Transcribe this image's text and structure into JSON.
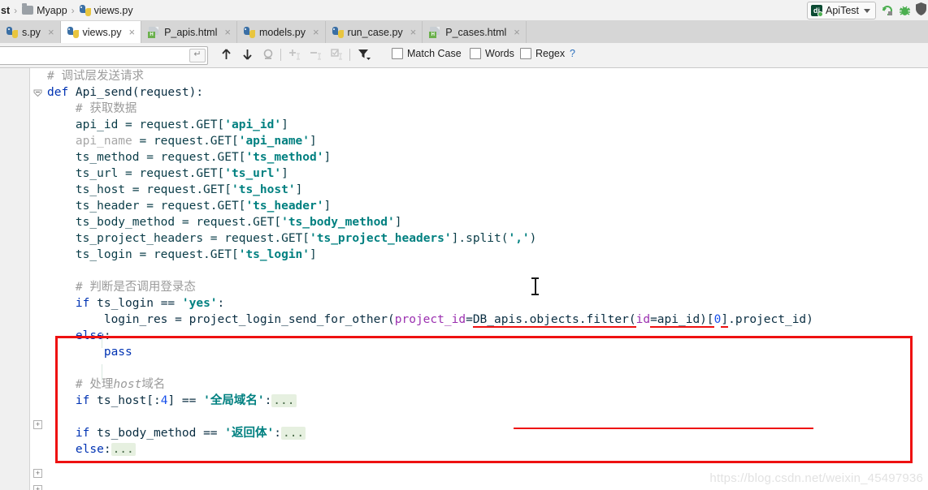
{
  "breadcrumb": {
    "items": [
      {
        "label": "st",
        "icon": "",
        "truncated": true
      },
      {
        "label": "Myapp",
        "icon": "folder-icon"
      },
      {
        "label": "views.py",
        "icon": "python-file-icon"
      }
    ],
    "separator": "›"
  },
  "run_widgets": {
    "config_name": "ApiTest",
    "config_icon": "django-icon",
    "dropdown_caret": "▾",
    "run_icon": "run-icon",
    "debug_icon": "debug-bug-icon",
    "coverage_icon": "shield-icon"
  },
  "tabs": [
    {
      "label": "s.py",
      "icon": "python-file-icon",
      "active": false,
      "close": "×",
      "truncated": true
    },
    {
      "label": "views.py",
      "icon": "python-file-icon",
      "active": true,
      "close": "×"
    },
    {
      "label": "P_apis.html",
      "icon": "html-file-icon",
      "active": false,
      "close": "×"
    },
    {
      "label": "models.py",
      "icon": "python-file-icon",
      "active": false,
      "close": "×"
    },
    {
      "label": "run_case.py",
      "icon": "python-file-icon",
      "active": false,
      "close": "×"
    },
    {
      "label": "P_cases.html",
      "icon": "html-file-icon",
      "active": false,
      "close": "×"
    }
  ],
  "find_bar": {
    "input_value": "",
    "input_placeholder": "",
    "enter_icon": "↵",
    "buttons": [
      {
        "name": "find-previous-button",
        "glyph": "↑",
        "enabled": true
      },
      {
        "name": "find-next-button",
        "glyph": "↓",
        "enabled": true
      },
      {
        "name": "select-all-occurrences-button",
        "glyph": "○",
        "enabled": true
      },
      {
        "name": "add-selection-button",
        "glyph": "+",
        "enabled": false
      },
      {
        "name": "remove-selection-button",
        "glyph": "−",
        "enabled": false
      },
      {
        "name": "select-all-button",
        "glyph": "☑",
        "enabled": false
      },
      {
        "name": "filter-button",
        "glyph": "▼",
        "enabled": true
      }
    ],
    "checkboxes": [
      {
        "label": "Match Case",
        "mnemonic": "C",
        "checked": false
      },
      {
        "label": "Words",
        "mnemonic": "o",
        "checked": false
      },
      {
        "label": "Regex",
        "mnemonic": "x",
        "checked": false
      }
    ],
    "help_label": "?",
    "scope_toggle": ""
  },
  "editor": {
    "language": "Python",
    "file": "views.py",
    "code_lines": [
      {
        "indent": 0,
        "tokens": [
          {
            "t": "cmt",
            "s": "# 调试层发送请求"
          }
        ],
        "fold": "collapse-arrow",
        "ctx": false
      },
      {
        "indent": 0,
        "tokens": [
          {
            "t": "kw",
            "s": "def"
          },
          {
            "t": "plain",
            "s": " Api_send(request):"
          }
        ],
        "ctx": false
      },
      {
        "indent": 1,
        "tokens": [
          {
            "t": "cmt",
            "s": "# 获取数据"
          }
        ],
        "ctx": true
      },
      {
        "indent": 1,
        "tokens": [
          {
            "t": "teal",
            "s": "api_id = request.GET["
          },
          {
            "t": "str",
            "s": "'api_id'"
          },
          {
            "t": "teal",
            "s": "]"
          }
        ],
        "ctx": true
      },
      {
        "indent": 1,
        "tokens": [
          {
            "t": "dim",
            "s": "api_name"
          },
          {
            "t": "teal",
            "s": " = request.GET["
          },
          {
            "t": "str",
            "s": "'api_name'"
          },
          {
            "t": "teal",
            "s": "]"
          }
        ],
        "ctx": true
      },
      {
        "indent": 1,
        "tokens": [
          {
            "t": "teal",
            "s": "ts_method = request.GET["
          },
          {
            "t": "str",
            "s": "'ts_method'"
          },
          {
            "t": "teal",
            "s": "]"
          }
        ],
        "ctx": true
      },
      {
        "indent": 1,
        "tokens": [
          {
            "t": "teal",
            "s": "ts_url = request.GET["
          },
          {
            "t": "str",
            "s": "'ts_url'"
          },
          {
            "t": "teal",
            "s": "]"
          }
        ],
        "ctx": true
      },
      {
        "indent": 1,
        "tokens": [
          {
            "t": "teal",
            "s": "ts_host = request.GET["
          },
          {
            "t": "str",
            "s": "'ts_host'"
          },
          {
            "t": "teal",
            "s": "]"
          }
        ],
        "ctx": true
      },
      {
        "indent": 1,
        "tokens": [
          {
            "t": "teal",
            "s": "ts_header = request.GET["
          },
          {
            "t": "str",
            "s": "'ts_header'"
          },
          {
            "t": "teal",
            "s": "]"
          }
        ],
        "ctx": true
      },
      {
        "indent": 1,
        "tokens": [
          {
            "t": "teal",
            "s": "ts_body_method = request.GET["
          },
          {
            "t": "str",
            "s": "'ts_body_method'"
          },
          {
            "t": "teal",
            "s": "]"
          }
        ],
        "ctx": true
      },
      {
        "indent": 1,
        "tokens": [
          {
            "t": "teal",
            "s": "ts_project_headers = request.GET["
          },
          {
            "t": "str",
            "s": "'ts_project_headers'"
          },
          {
            "t": "teal",
            "s": "].split("
          },
          {
            "t": "str",
            "s": "','"
          },
          {
            "t": "teal",
            "s": ")"
          }
        ],
        "ctx": true
      },
      {
        "indent": 1,
        "tokens": [
          {
            "t": "teal",
            "s": "ts_login = request.GET["
          },
          {
            "t": "str",
            "s": "'ts_login'"
          },
          {
            "t": "teal",
            "s": "]"
          }
        ],
        "ctx": true
      },
      {
        "indent": 0,
        "tokens": [],
        "ctx": false
      },
      {
        "indent": 1,
        "tokens": [
          {
            "t": "cmt",
            "s": "# 判断是否调用登录态"
          }
        ],
        "ctx": true
      },
      {
        "indent": 1,
        "tokens": [
          {
            "t": "kw",
            "s": "if"
          },
          {
            "t": "plain",
            "s": " ts_login == "
          },
          {
            "t": "str",
            "s": "'yes'"
          },
          {
            "t": "plain",
            "s": ":"
          }
        ],
        "ctx": true
      },
      {
        "indent": 2,
        "tokens": [
          {
            "t": "plain",
            "s": "login_res = project_login_send_for_other("
          },
          {
            "t": "kwarg",
            "s": "project_id"
          },
          {
            "t": "plain",
            "s": "="
          },
          {
            "t": "errul",
            "s": "DB_apis.objects.filter("
          },
          {
            "t": "kwargul",
            "s": "id"
          },
          {
            "t": "errul",
            "s": "=api_id)["
          },
          {
            "t": "numul",
            "s": "0"
          },
          {
            "t": "errul",
            "s": "]"
          },
          {
            "t": "plain",
            "s": ".project_id)"
          }
        ],
        "ctx": true
      },
      {
        "indent": 1,
        "tokens": [
          {
            "t": "kw",
            "s": "else"
          },
          {
            "t": "plain",
            "s": ":"
          }
        ],
        "ctx": true
      },
      {
        "indent": 2,
        "tokens": [
          {
            "t": "kw",
            "s": "pass"
          }
        ],
        "ctx": true
      },
      {
        "indent": 0,
        "tokens": [],
        "ctx": false
      },
      {
        "indent": 1,
        "tokens": [
          {
            "t": "cmt",
            "s": "# 处理"
          },
          {
            "t": "cmti",
            "s": "host"
          },
          {
            "t": "cmt",
            "s": "域名"
          }
        ],
        "ctx": true
      },
      {
        "indent": 1,
        "tokens": [
          {
            "t": "kw",
            "s": "if"
          },
          {
            "t": "plain",
            "s": " ts_host[:"
          },
          {
            "t": "num",
            "s": "4"
          },
          {
            "t": "plain",
            "s": "] == "
          },
          {
            "t": "str",
            "s": "'全局域名'"
          },
          {
            "t": "plain",
            "s": ":"
          },
          {
            "t": "fold",
            "s": "..."
          }
        ],
        "fold": "expand-plus",
        "ctx": true
      },
      {
        "indent": 0,
        "tokens": [],
        "ctx": false
      },
      {
        "indent": 1,
        "tokens": [
          {
            "t": "kw",
            "s": "if"
          },
          {
            "t": "plain",
            "s": " ts_body_method == "
          },
          {
            "t": "str",
            "s": "'返回体'"
          },
          {
            "t": "plain",
            "s": ":"
          },
          {
            "t": "fold",
            "s": "..."
          }
        ],
        "fold": "expand-plus",
        "ctx": true
      },
      {
        "indent": 1,
        "tokens": [
          {
            "t": "kw",
            "s": "else"
          },
          {
            "t": "plain",
            "s": ":"
          },
          {
            "t": "fold",
            "s": "..."
          }
        ],
        "fold": "expand-plus",
        "ctx": true
      }
    ]
  },
  "annotations": {
    "red_box_label": "highlight-rectangle",
    "red_underline_label": "error-underline"
  },
  "watermark": "https://blog.csdn.net/weixin_45497936",
  "colors": {
    "accent_red": "#ee1111",
    "string_teal": "#008080",
    "keyword_blue": "#0033b3",
    "kwarg_purple": "#9b30b0",
    "comment_gray": "#9b9b9b",
    "tabbar_bg": "#d6d6d6",
    "context_yellow": "#fdfbe8"
  }
}
